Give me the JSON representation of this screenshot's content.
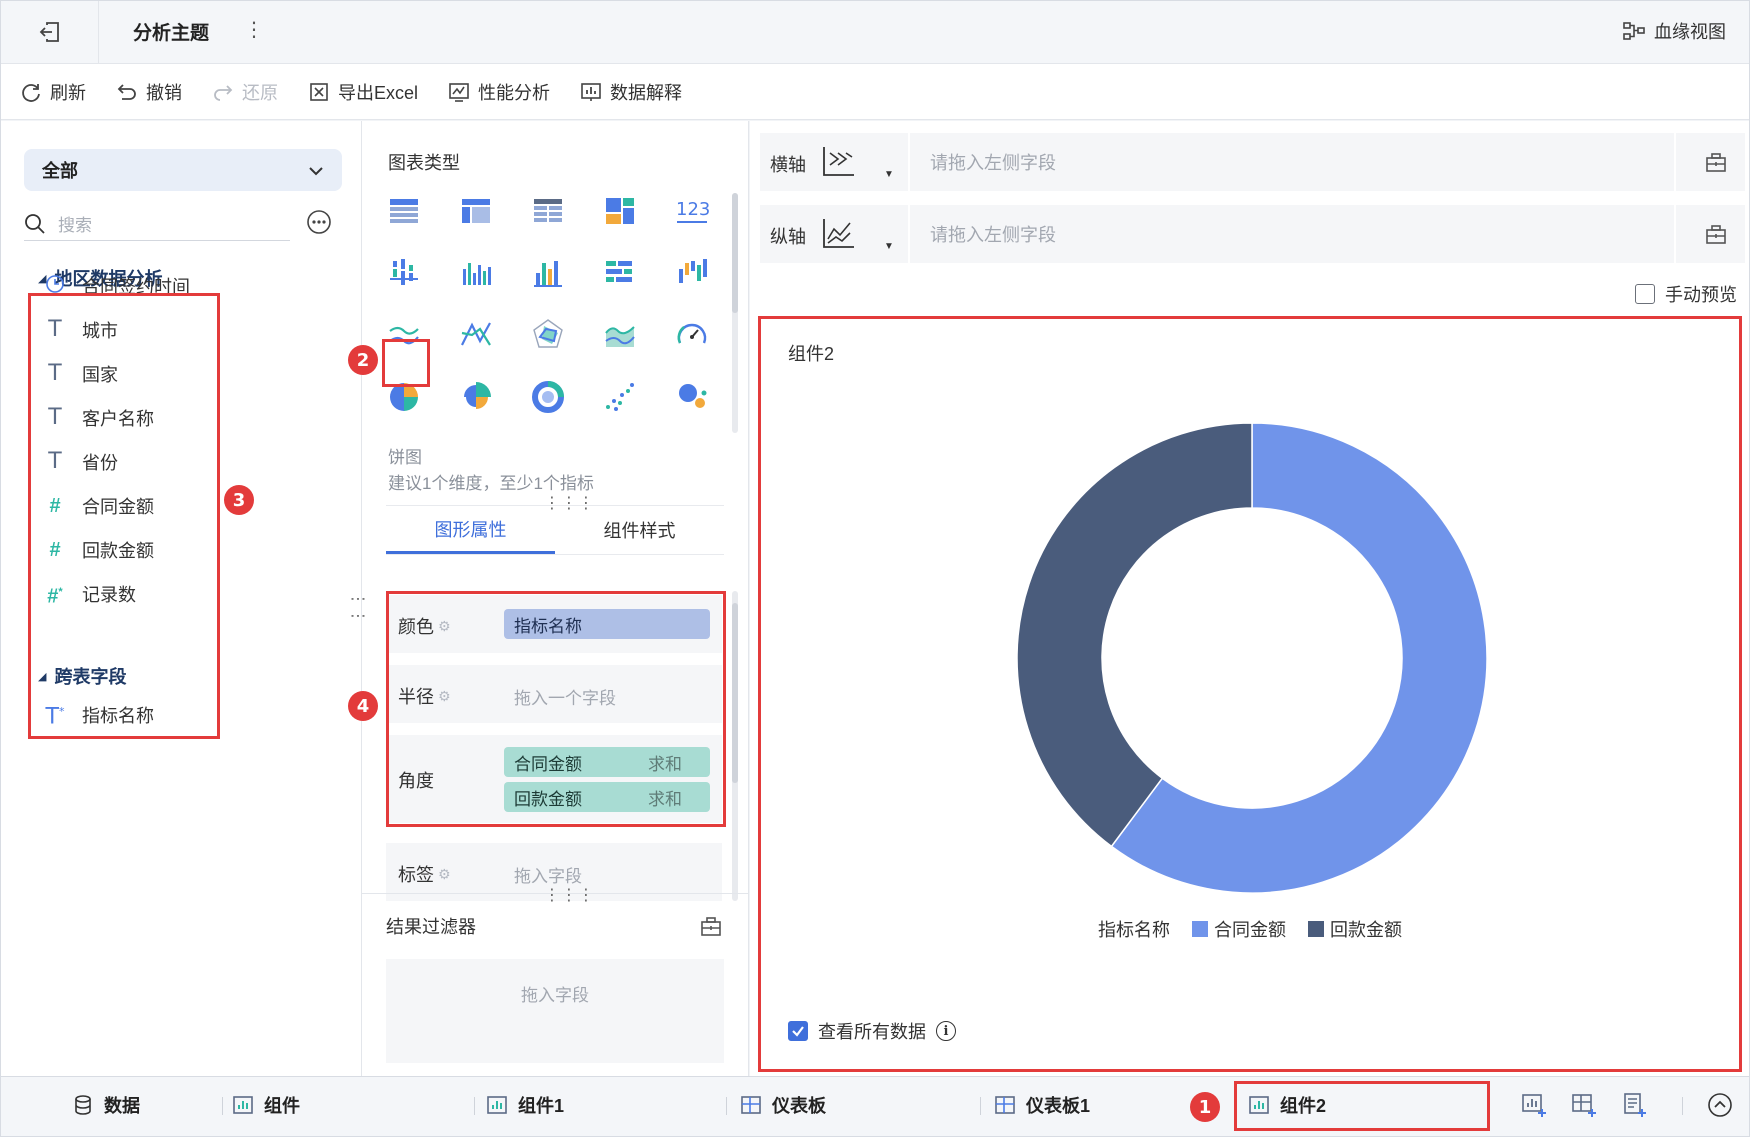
{
  "header": {
    "title": "分析主题",
    "more": "⋮",
    "lineage_label": "血缘视图"
  },
  "toolbar": {
    "refresh": "刷新",
    "undo": "撤销",
    "redo": "还原",
    "export_excel": "导出Excel",
    "performance": "性能分析",
    "explain": "数据解释"
  },
  "left_panel": {
    "scope": "全部",
    "search_placeholder": "搜索",
    "groups": [
      {
        "name": "地区数据分析",
        "fields": [
          {
            "type": "date",
            "label": "合同签约时间"
          },
          {
            "type": "text",
            "label": "城市"
          },
          {
            "type": "text",
            "label": "国家"
          },
          {
            "type": "text",
            "label": "客户名称"
          },
          {
            "type": "text",
            "label": "省份"
          },
          {
            "type": "number",
            "label": "合同金额"
          },
          {
            "type": "number",
            "label": "回款金额"
          },
          {
            "type": "number-calc",
            "label": "记录数"
          }
        ]
      },
      {
        "name": "跨表字段",
        "fields": [
          {
            "type": "text-calc",
            "label": "指标名称"
          }
        ]
      }
    ]
  },
  "middle_panel": {
    "chart_types_title": "图表类型",
    "selected_chart_name": "饼图",
    "selected_chart_hint": "建议1个维度，至少1个指标",
    "tabs": [
      "图形属性",
      "组件样式"
    ],
    "properties": {
      "color_label": "颜色",
      "color_field": "指标名称",
      "radius_label": "半径",
      "radius_hint": "拖入一个字段",
      "angle_label": "角度",
      "angle_fields": [
        {
          "field": "合同金额",
          "agg": "求和"
        },
        {
          "field": "回款金额",
          "agg": "求和"
        }
      ],
      "label_label": "标签",
      "label_hint": "拖入字段"
    },
    "filter_title": "结果过滤器",
    "filter_hint": "拖入字段"
  },
  "right_panel": {
    "x_axis_label": "横轴",
    "y_axis_label": "纵轴",
    "axis_placeholder": "请拖入左侧字段",
    "manual_preview": "手动预览",
    "widget_title": "组件2",
    "view_all_data": "查看所有数据",
    "info_icon": "i"
  },
  "annotations": [
    "1",
    "2",
    "3",
    "4"
  ],
  "chart_data": {
    "type": "pie",
    "title": "组件2",
    "legend_title": "指标名称",
    "legend_position": "bottom",
    "categories": [
      "合同金额",
      "回款金额"
    ],
    "values": [
      60.2,
      39.8
    ],
    "colors": [
      "#7094ea",
      "#4a5c7c"
    ],
    "donut": true
  },
  "bottom_tabs": {
    "data": "数据",
    "component": "组件",
    "component1": "组件1",
    "dashboard": "仪表板",
    "dashboard1": "仪表板1",
    "component2": "组件2"
  },
  "colors": {
    "accent": "#3f6fdb",
    "annotation_red": "#e33b3b",
    "teal_field": "#2db7a4"
  }
}
